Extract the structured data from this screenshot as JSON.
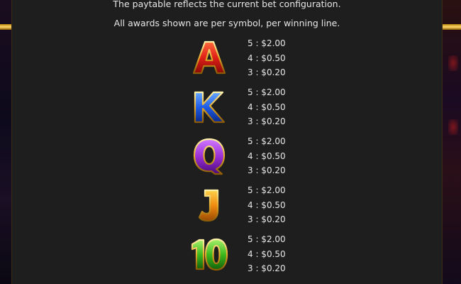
{
  "info": {
    "line1": "The paytable reflects the current bet configuration.",
    "line2": "All awards shown are per symbol, per winning line."
  },
  "symbols": [
    {
      "glyph": "A",
      "icon": "letter-a-symbol-icon",
      "color": "#e02018",
      "payouts": [
        "5 : $2.00",
        "4 : $0.50",
        "3 : $0.20"
      ]
    },
    {
      "glyph": "K",
      "icon": "letter-k-symbol-icon",
      "color": "#1e5ce6",
      "payouts": [
        "5 : $2.00",
        "4 : $0.50",
        "3 : $0.20"
      ]
    },
    {
      "glyph": "Q",
      "icon": "letter-q-symbol-icon",
      "color": "#9a2fd6",
      "payouts": [
        "5 : $2.00",
        "4 : $0.50",
        "3 : $0.20"
      ]
    },
    {
      "glyph": "J",
      "icon": "letter-j-symbol-icon",
      "color": "#f08a10",
      "payouts": [
        "5 : $2.00",
        "4 : $0.50",
        "3 : $0.20"
      ]
    },
    {
      "glyph": "10",
      "icon": "number-ten-symbol-icon",
      "color": "#3cb81e",
      "payouts": [
        "5 : $2.00",
        "4 : $0.50",
        "3 : $0.20"
      ]
    }
  ]
}
